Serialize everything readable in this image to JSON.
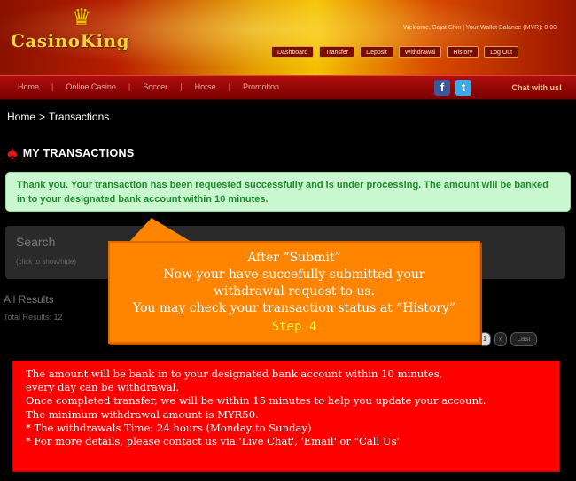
{
  "header": {
    "logo_text": "CasinoKing",
    "welcome_text": "Welcome, Bajat Chin | Your Wallet Balance (MYR): 0.00",
    "buttons": [
      "Dashboard",
      "Transfer",
      "Deposit",
      "Withdrawal",
      "History",
      "Log Out"
    ]
  },
  "nav": {
    "items": [
      "Home",
      "Online Casino",
      "Soccer",
      "Horse",
      "Promotion"
    ],
    "social": {
      "facebook": "f",
      "twitter": "t"
    },
    "chat": "Chat with us!"
  },
  "breadcrumb": {
    "home": "Home",
    "sep": ">",
    "current": "Transactions"
  },
  "page_title": "MY TRANSACTIONS",
  "success_message": "Thank you. Your transaction has been requested successfully and is under processing. The amount will be banked in to your designated bank account within 10 minutes.",
  "search": {
    "title": "Search",
    "hint": "(click to show/hide)"
  },
  "results": {
    "heading": "All Results",
    "total": "Total Results: 12"
  },
  "pager": {
    "current": "1",
    "next": "»",
    "last": "Last"
  },
  "callout": {
    "lines": [
      "After “Submit”",
      "Now your have succefully submitted your",
      "withdrawal request to us.",
      "You may check your transaction status at “History”"
    ],
    "step": "Step 4"
  },
  "info": {
    "lines": [
      "The amount will be bank in to your designated bank account within 10 minutes,",
      "every day can be withdrawal.",
      "Once completed transfer, we will be within 15 minutes to help you update your account.",
      "The minimum withdrawal amount is MYR50.",
      "* The withdrawals Time: 24 hours (Monday to Sunday)",
      "* For more details, please contact us via 'Live Chat', 'Email' or \"Call Us'"
    ]
  },
  "colors": {
    "success_bg": "#c9f7cf",
    "success_text": "#1f8a2e",
    "callout_bg": "#ff8400",
    "step_text": "#ffef36",
    "info_bg": "#ff0000",
    "nav_bg": "#9a0000"
  },
  "icons": {
    "title_icon": "spade-icon",
    "logo_icon": "crown-icon"
  }
}
